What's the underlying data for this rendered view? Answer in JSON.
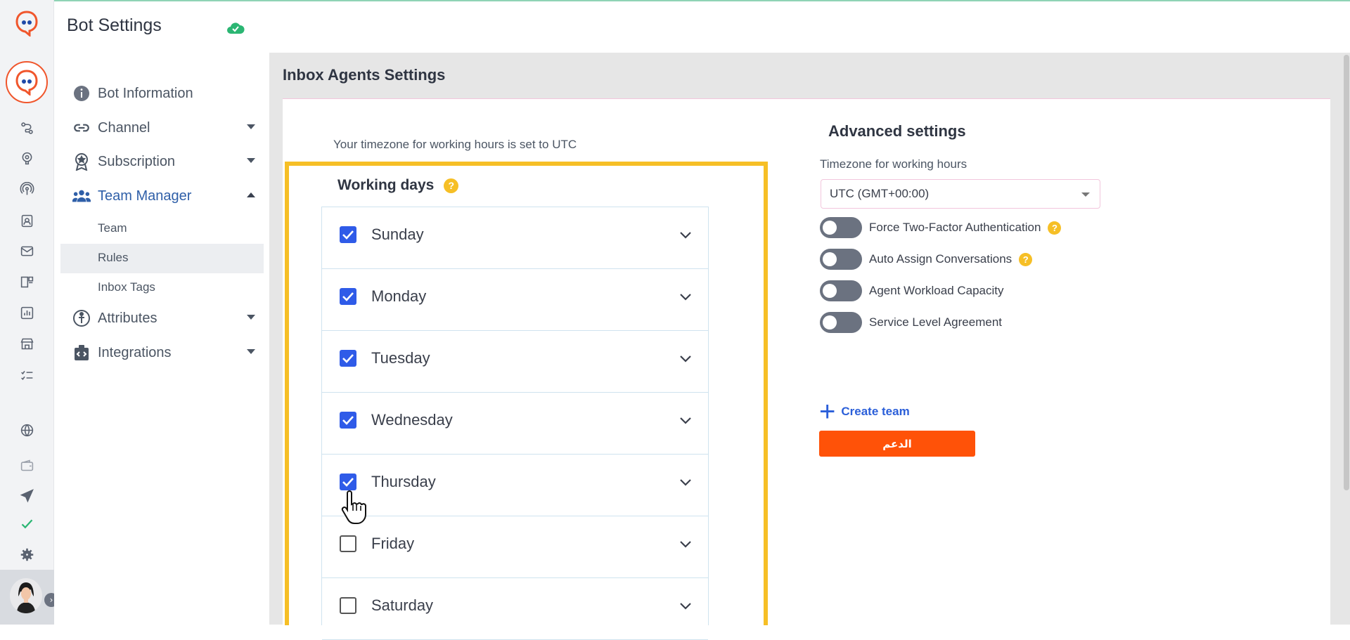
{
  "header": {
    "title": "Bot Settings"
  },
  "sidebar": {
    "items": [
      {
        "label": "Bot Information",
        "icon": "info-icon"
      },
      {
        "label": "Channel",
        "icon": "link-icon"
      },
      {
        "label": "Subscription",
        "icon": "award-icon"
      },
      {
        "label": "Team Manager",
        "icon": "users-icon"
      },
      {
        "label": "Attributes",
        "icon": "person-icon"
      },
      {
        "label": "Integrations",
        "icon": "integration-icon"
      }
    ],
    "sub_items": [
      {
        "label": "Team"
      },
      {
        "label": "Rules"
      },
      {
        "label": "Inbox Tags"
      }
    ],
    "selected_sub_item": "Rules"
  },
  "main": {
    "heading": "Inbox Agents Settings",
    "timezone_note": "Your timezone for working hours is set to UTC",
    "working_days": {
      "title": "Working days",
      "help": "?",
      "days": [
        {
          "label": "Sunday",
          "checked": true
        },
        {
          "label": "Monday",
          "checked": true
        },
        {
          "label": "Tuesday",
          "checked": true
        },
        {
          "label": "Wednesday",
          "checked": true
        },
        {
          "label": "Thursday",
          "checked": true
        },
        {
          "label": "Friday",
          "checked": false
        },
        {
          "label": "Saturday",
          "checked": false
        }
      ]
    },
    "advanced": {
      "title": "Advanced settings",
      "timezone_label": "Timezone for working hours",
      "timezone_value": "UTC (GMT+00:00)",
      "toggles": [
        {
          "label": "Force Two-Factor Authentication",
          "on": false,
          "help": "?"
        },
        {
          "label": "Auto Assign Conversations",
          "on": false,
          "help": "?"
        },
        {
          "label": "Agent Workload Capacity",
          "on": false
        },
        {
          "label": "Service Level Agreement",
          "on": false
        }
      ],
      "create_team": "Create team",
      "support_button": "الدعم"
    }
  },
  "colors": {
    "accent": "#2f5be8",
    "highlight": "#f6bf26",
    "support": "#ff5208",
    "brand": "#f0562c"
  }
}
